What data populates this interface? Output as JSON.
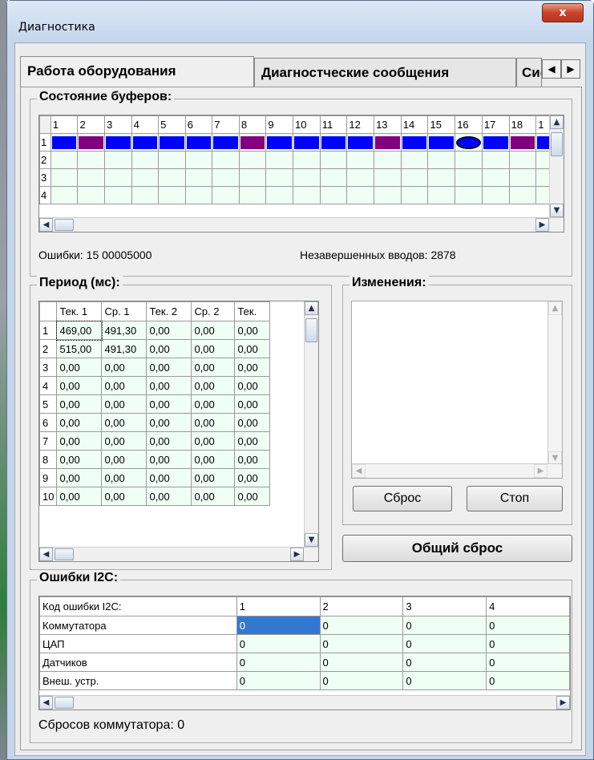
{
  "window": {
    "title": "Диагностика",
    "close_label": "x"
  },
  "tabs": [
    {
      "label": "Работа оборудования"
    },
    {
      "label": "Диагностческие сообщения"
    },
    {
      "label": "Сис"
    }
  ],
  "tab_arrows": {
    "left": "◀",
    "right": "▶"
  },
  "buffers": {
    "title": "Состояние буферов:",
    "columns": [
      "1",
      "2",
      "3",
      "4",
      "5",
      "6",
      "7",
      "8",
      "9",
      "10",
      "11",
      "12",
      "13",
      "14",
      "15",
      "16",
      "17",
      "18",
      "1"
    ],
    "rows": [
      "1",
      "2",
      "3",
      "4"
    ],
    "row1_colors": [
      "#0000ff",
      "#800080",
      "#0000ff",
      "#0000ff",
      "#0000ff",
      "#0000ff",
      "#0000ff",
      "#800080",
      "#0000ff",
      "#0000ff",
      "#0000ff",
      "#0000ff",
      "#800080",
      "#0000ff",
      "#0000ff",
      "#0000ff",
      "#0000ff",
      "#800080",
      "#0000ff"
    ],
    "errors_label": "Ошибки: 15 00005000",
    "incomplete_label": "Незавершенных вводов: 2878"
  },
  "period": {
    "title": "Период (мс):",
    "headers": [
      "",
      "Тек. 1",
      "Ср. 1",
      "Тек. 2",
      "Ср. 2",
      "Тек."
    ],
    "rows": [
      [
        "1",
        "469,00",
        "491,30",
        "0,00",
        "0,00",
        "0,00"
      ],
      [
        "2",
        "515,00",
        "491,30",
        "0,00",
        "0,00",
        "0,00"
      ],
      [
        "3",
        "0,00",
        "0,00",
        "0,00",
        "0,00",
        "0,00"
      ],
      [
        "4",
        "0,00",
        "0,00",
        "0,00",
        "0,00",
        "0,00"
      ],
      [
        "5",
        "0,00",
        "0,00",
        "0,00",
        "0,00",
        "0,00"
      ],
      [
        "6",
        "0,00",
        "0,00",
        "0,00",
        "0,00",
        "0,00"
      ],
      [
        "7",
        "0,00",
        "0,00",
        "0,00",
        "0,00",
        "0,00"
      ],
      [
        "8",
        "0,00",
        "0,00",
        "0,00",
        "0,00",
        "0,00"
      ],
      [
        "9",
        "0,00",
        "0,00",
        "0,00",
        "0,00",
        "0,00"
      ],
      [
        "10",
        "0,00",
        "0,00",
        "0,00",
        "0,00",
        "0,00"
      ]
    ]
  },
  "changes": {
    "title": "Изменения:",
    "reset_label": "Сброс",
    "stop_label": "Стоп"
  },
  "general_reset_label": "Общий сброс",
  "i2c": {
    "title": "Ошибки I2C:",
    "headers": [
      "Код ошибки I2C:",
      "1",
      "2",
      "3",
      "4"
    ],
    "rows": [
      [
        "Коммутатора",
        "0",
        "0",
        "0",
        "0"
      ],
      [
        "ЦАП",
        "0",
        "0",
        "0",
        "0"
      ],
      [
        "Датчиков",
        "0",
        "0",
        "0",
        "0"
      ],
      [
        "Внеш. устр.",
        "0",
        "0",
        "0",
        "0"
      ]
    ],
    "resets_label": "Сбросов коммутатора: 0"
  }
}
